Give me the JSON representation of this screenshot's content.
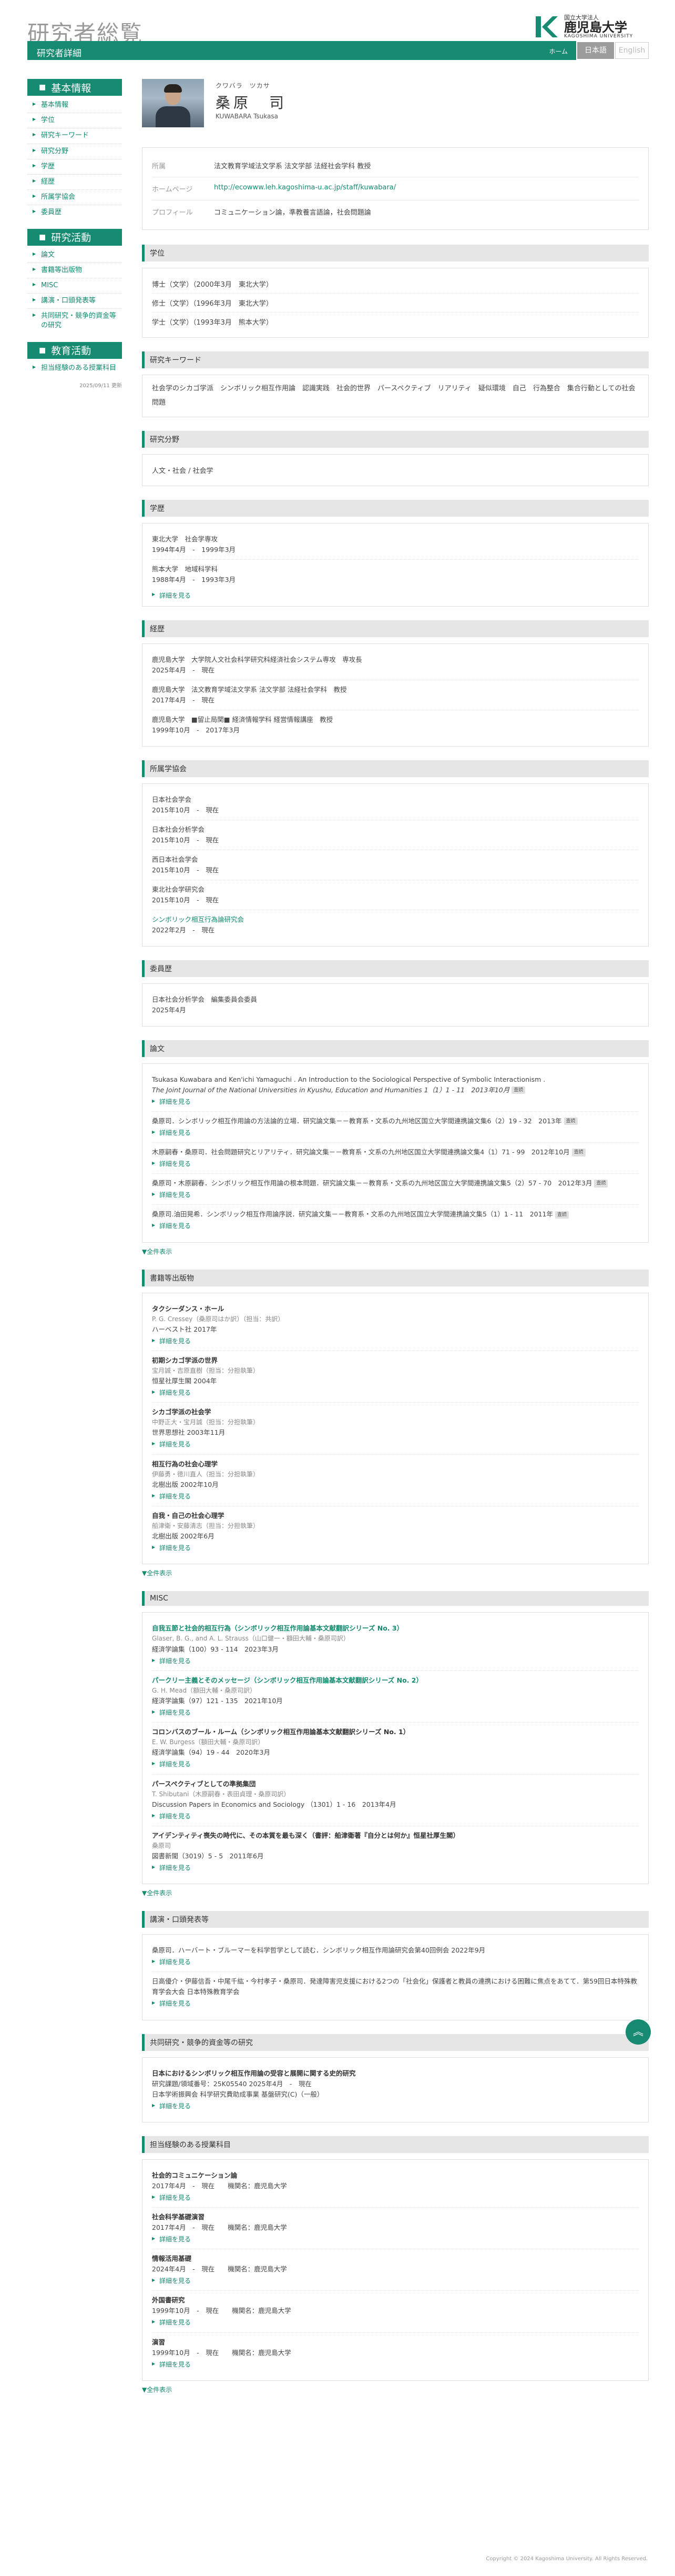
{
  "site": {
    "title": "研究者総覧",
    "page_title": "研究者詳細",
    "home": "ホーム",
    "lang_ja": "日本語",
    "lang_en": "English",
    "logo_small": "国立大学法人",
    "logo_big": "鹿児島大学",
    "logo_en": "KAGOSHIMA UNIVERSITY",
    "copyright": "Copyright © 2024 Kagoshima University. All Rights Reserved."
  },
  "sidebar": {
    "basic_head": "基本情報",
    "basic_items": [
      "基本情報",
      "学位",
      "研究キーワード",
      "研究分野",
      "学歴",
      "経歴",
      "所属学協会",
      "委員歴"
    ],
    "research_head": "研究活動",
    "research_items": [
      "論文",
      "書籍等出版物",
      "MISC",
      "講演・口頭発表等",
      "共同研究・競争的資金等の研究"
    ],
    "education_head": "教育活動",
    "education_items": [
      "担当経験のある授業科目"
    ],
    "date": "2025/09/11 更新"
  },
  "profile": {
    "kana": "クワバラ　ツカサ",
    "name": "桑原　司",
    "roman": "KUWABARA Tsukasa",
    "rows": [
      {
        "label": "所属",
        "value": "法文教育学域法文学系 法文学部 法経社会学科 教授"
      },
      {
        "label": "ホームページ",
        "value": "http://ecowww.leh.kagoshima-u.ac.jp/staff/kuwabara/"
      },
      {
        "label": "プロフィール",
        "value": "コミュニケーション論，準教養言語論，社会問題論"
      }
    ]
  },
  "degrees": {
    "head": "学位",
    "items": [
      "博士（文学）（2000年3月　東北大学）",
      "修士（文学）（1996年3月　東北大学）",
      "学士（文学）（1993年3月　熊本大学）"
    ]
  },
  "keywords": {
    "head": "研究キーワード",
    "text": "社会学のシカゴ学派　シンボリック相互作用論　認識実践　社会的世界　パースペクティブ　リアリティ　疑似環境　自己　行為整合　集合行動としての社会問題"
  },
  "fields": {
    "head": "研究分野",
    "text": "人文・社会 / 社会学"
  },
  "education": {
    "head": "学歴",
    "items": [
      {
        "title": "東北大学　社会学専攻",
        "period": "1994年4月　-　1999年3月"
      },
      {
        "title": "熊本大学　地域科学科",
        "period": "1988年4月　-　1993年3月"
      }
    ],
    "more": "詳細を見る"
  },
  "career": {
    "head": "経歴",
    "items": [
      {
        "title": "鹿児島大学　大学院人文社会科学研究科経済社会システム専攻　専攻長",
        "period": "2025年4月　-　現在"
      },
      {
        "title": "鹿児島大学　法文教育学域法文学系 法文学部 法経社会学科　教授",
        "period": "2017年4月　-　現在"
      },
      {
        "title": "鹿児島大学　■留止局関■ 経済情報学科 経営情報講座　教授",
        "period": "1999年10月　-　2017年3月"
      }
    ]
  },
  "societies": {
    "head": "所属学協会",
    "items": [
      {
        "title": "日本社会学会",
        "period": "2015年10月　-　現在"
      },
      {
        "title": "日本社会分析学会",
        "period": "2015年10月　-　現在"
      },
      {
        "title": "西日本社会学会",
        "period": "2015年10月　-　現在"
      },
      {
        "title": "東北社会学研究会",
        "period": "2015年10月　-　現在"
      },
      {
        "title": "シンボリック相互行為論研究会",
        "period": "2022年2月　-　現在"
      }
    ]
  },
  "committees": {
    "head": "委員歴",
    "items": [
      {
        "title": "日本社会分析学会　編集委員会委員",
        "period": "2025年4月"
      }
    ]
  },
  "papers": {
    "head": "論文",
    "items": [
      {
        "text": "Tsukasa Kuwabara and Ken'ichi Yamaguchi . An Introduction to the Sociological Perspective of Symbolic Interactionism .",
        "journal": "The Joint Journal of the National Universities in Kyushu, Education and Humanities 1（1）1 - 11　2013年10月",
        "badge": "査読",
        "more": "詳細を見る"
      },
      {
        "text": "桑原司．シンボリック相互作用論の方法論的立場．研究論文集－－教育系・文系の九州地区国立大学間連携論文集6（2）19 - 32　2013年",
        "badge": "査読",
        "more": "詳細を見る"
      },
      {
        "text": "木原嗣春・桑原司．社会問題研究とリアリティ．研究論文集－－教育系・文系の九州地区国立大学間連携論文集4（1）71 - 99　2012年10月",
        "badge": "査読",
        "more": "詳細を見る"
      },
      {
        "text": "桑原司・木原嗣春．シンボリック相互作用論の根本問題．研究論文集－－教育系・文系の九州地区国立大学間連携論文集5（2）57 - 70　2012年3月",
        "badge": "査読",
        "more": "詳細を見る"
      },
      {
        "text": "桑原司.油田晃希．シンボリック相互作用論序説．研究論文集－－教育系・文系の九州地区国立大学間連携論文集5（1）1 - 11　2011年",
        "badge": "査読",
        "more": "詳細を見る"
      }
    ],
    "showall": "▼全件表示"
  },
  "books": {
    "head": "書籍等出版物",
    "items": [
      {
        "title": "タクシーダンス・ホール",
        "authors": "P. G. Cressey（桑原司はか訳）（担当：共訳）",
        "pub": "ハーベスト社  2017年",
        "more": "詳細を見る"
      },
      {
        "title": "初期シカゴ学派の世界",
        "authors": "宝月誠・吉原直樹（担当：分担執筆）",
        "pub": "恒星社厚生閣  2004年",
        "more": "詳細を見る"
      },
      {
        "title": "シカゴ学派の社会学",
        "authors": "中野正大・宝月誠（担当：分担執筆）",
        "pub": "世界思想社  2003年11月",
        "more": "詳細を見る"
      },
      {
        "title": "相互行為の社会心理学",
        "authors": "伊藤勇・徳川直人（担当：分担執筆）",
        "pub": "北樹出版  2002年10月",
        "more": "詳細を見る"
      },
      {
        "title": "自我・自己の社会心理学",
        "authors": "船津衛・安藤清志（担当：分担執筆）",
        "pub": "北樹出版  2002年6月",
        "more": "詳細を見る"
      }
    ],
    "showall": "▼全件表示"
  },
  "misc": {
    "head": "MISC",
    "items": [
      {
        "title": "自我五節と社会的相互行為（シンボリック相互作用論基本文献翻訳シリーズ No. 3）",
        "authors": "Glaser, B. G., and A. L. Strauss（山口健一・額田大輔・桑原司訳）",
        "pub": "経済学論集（100）93 - 114　2023年3月",
        "more": "詳細を見る",
        "link": true
      },
      {
        "title": "パークリー主義とそのメッセージ（シンボリック相互作用論基本文献翻訳シリーズ No. 2）",
        "authors": "G. H. Mead（額田大輔・桑原司訳）",
        "pub": "経済学論集（97）121 - 135　2021年10月",
        "more": "詳細を見る",
        "link": true
      },
      {
        "title": "コロンバスのブール・ルーム（シンボリック相互作用論基本文献翻訳シリーズ No. 1）",
        "authors": "E. W. Burgess（額田大輔・桑原司訳）",
        "pub": "経済学論集（94）19 - 44　2020年3月",
        "more": "詳細を見る",
        "link": false
      },
      {
        "title": "パースペクティブとしての準拠集団",
        "authors": "T. Shibutani（木原嗣春・表田貞理・桑原司訳）",
        "pub": "Discussion Papers in Economics and Sociology （1301）1 - 16　2013年4月",
        "more": "詳細を見る",
        "link": false
      },
      {
        "title": "アイデンティティ喪失の時代に、その本質を最も深く（書評：船津衛著『自分とは何か』恒星社厚生閣）",
        "authors": "桑原司",
        "pub": "図書新聞（3019）5 - 5　2011年6月",
        "more": "詳細を見る",
        "link": false
      }
    ],
    "showall": "▼全件表示"
  },
  "talks": {
    "head": "講演・口頭発表等",
    "items": [
      {
        "text": "桑原司．ハーバート・ブルーマーを科学哲学として読む．シンボリック相互作用論研究会第40回例会  2022年9月",
        "more": "詳細を見る"
      },
      {
        "text": "日高優介・伊藤信吾・中尾千紘・今村孝子・桑原司．発達障害児支援における2つの「社会化」保護者と教員の連携における困難に焦点をあてて．第59回日本特殊教育学会大会  日本特殊教育学会",
        "more": "詳細を見る"
      }
    ]
  },
  "grants": {
    "head": "共同研究・競争的資金等の研究",
    "items": [
      {
        "title": "日本におけるシンボリック相互作用論の受容と展開に関する史的研究",
        "meta1": "研究課題/領域番号：25K05540  2025年4月　-　現在",
        "meta2": "日本学術振興会  科学研究費助成事業  基盤研究(C)（一般）",
        "more": "詳細を見る"
      }
    ]
  },
  "courses": {
    "head": "担当経験のある授業科目",
    "items": [
      {
        "title": "社会的コミュニケーション論",
        "period": "2017年4月　-　現在",
        "inst": "機関名：鹿児島大学",
        "more": "詳細を見る"
      },
      {
        "title": "社会科学基礎演習",
        "period": "2017年4月　-　現在",
        "inst": "機関名：鹿児島大学",
        "more": "詳細を見る"
      },
      {
        "title": "情報活用基礎",
        "period": "2024年4月　-　現在",
        "inst": "機関名：鹿児島大学",
        "more": "詳細を見る"
      },
      {
        "title": "外国書研究",
        "period": "1999年10月　-　現在",
        "inst": "機関名：鹿児島大学",
        "more": "詳細を見る"
      },
      {
        "title": "演習",
        "period": "1999年10月　-　現在",
        "inst": "機関名：鹿児島大学",
        "more": "詳細を見る"
      }
    ],
    "showall": "▼全件表示"
  }
}
